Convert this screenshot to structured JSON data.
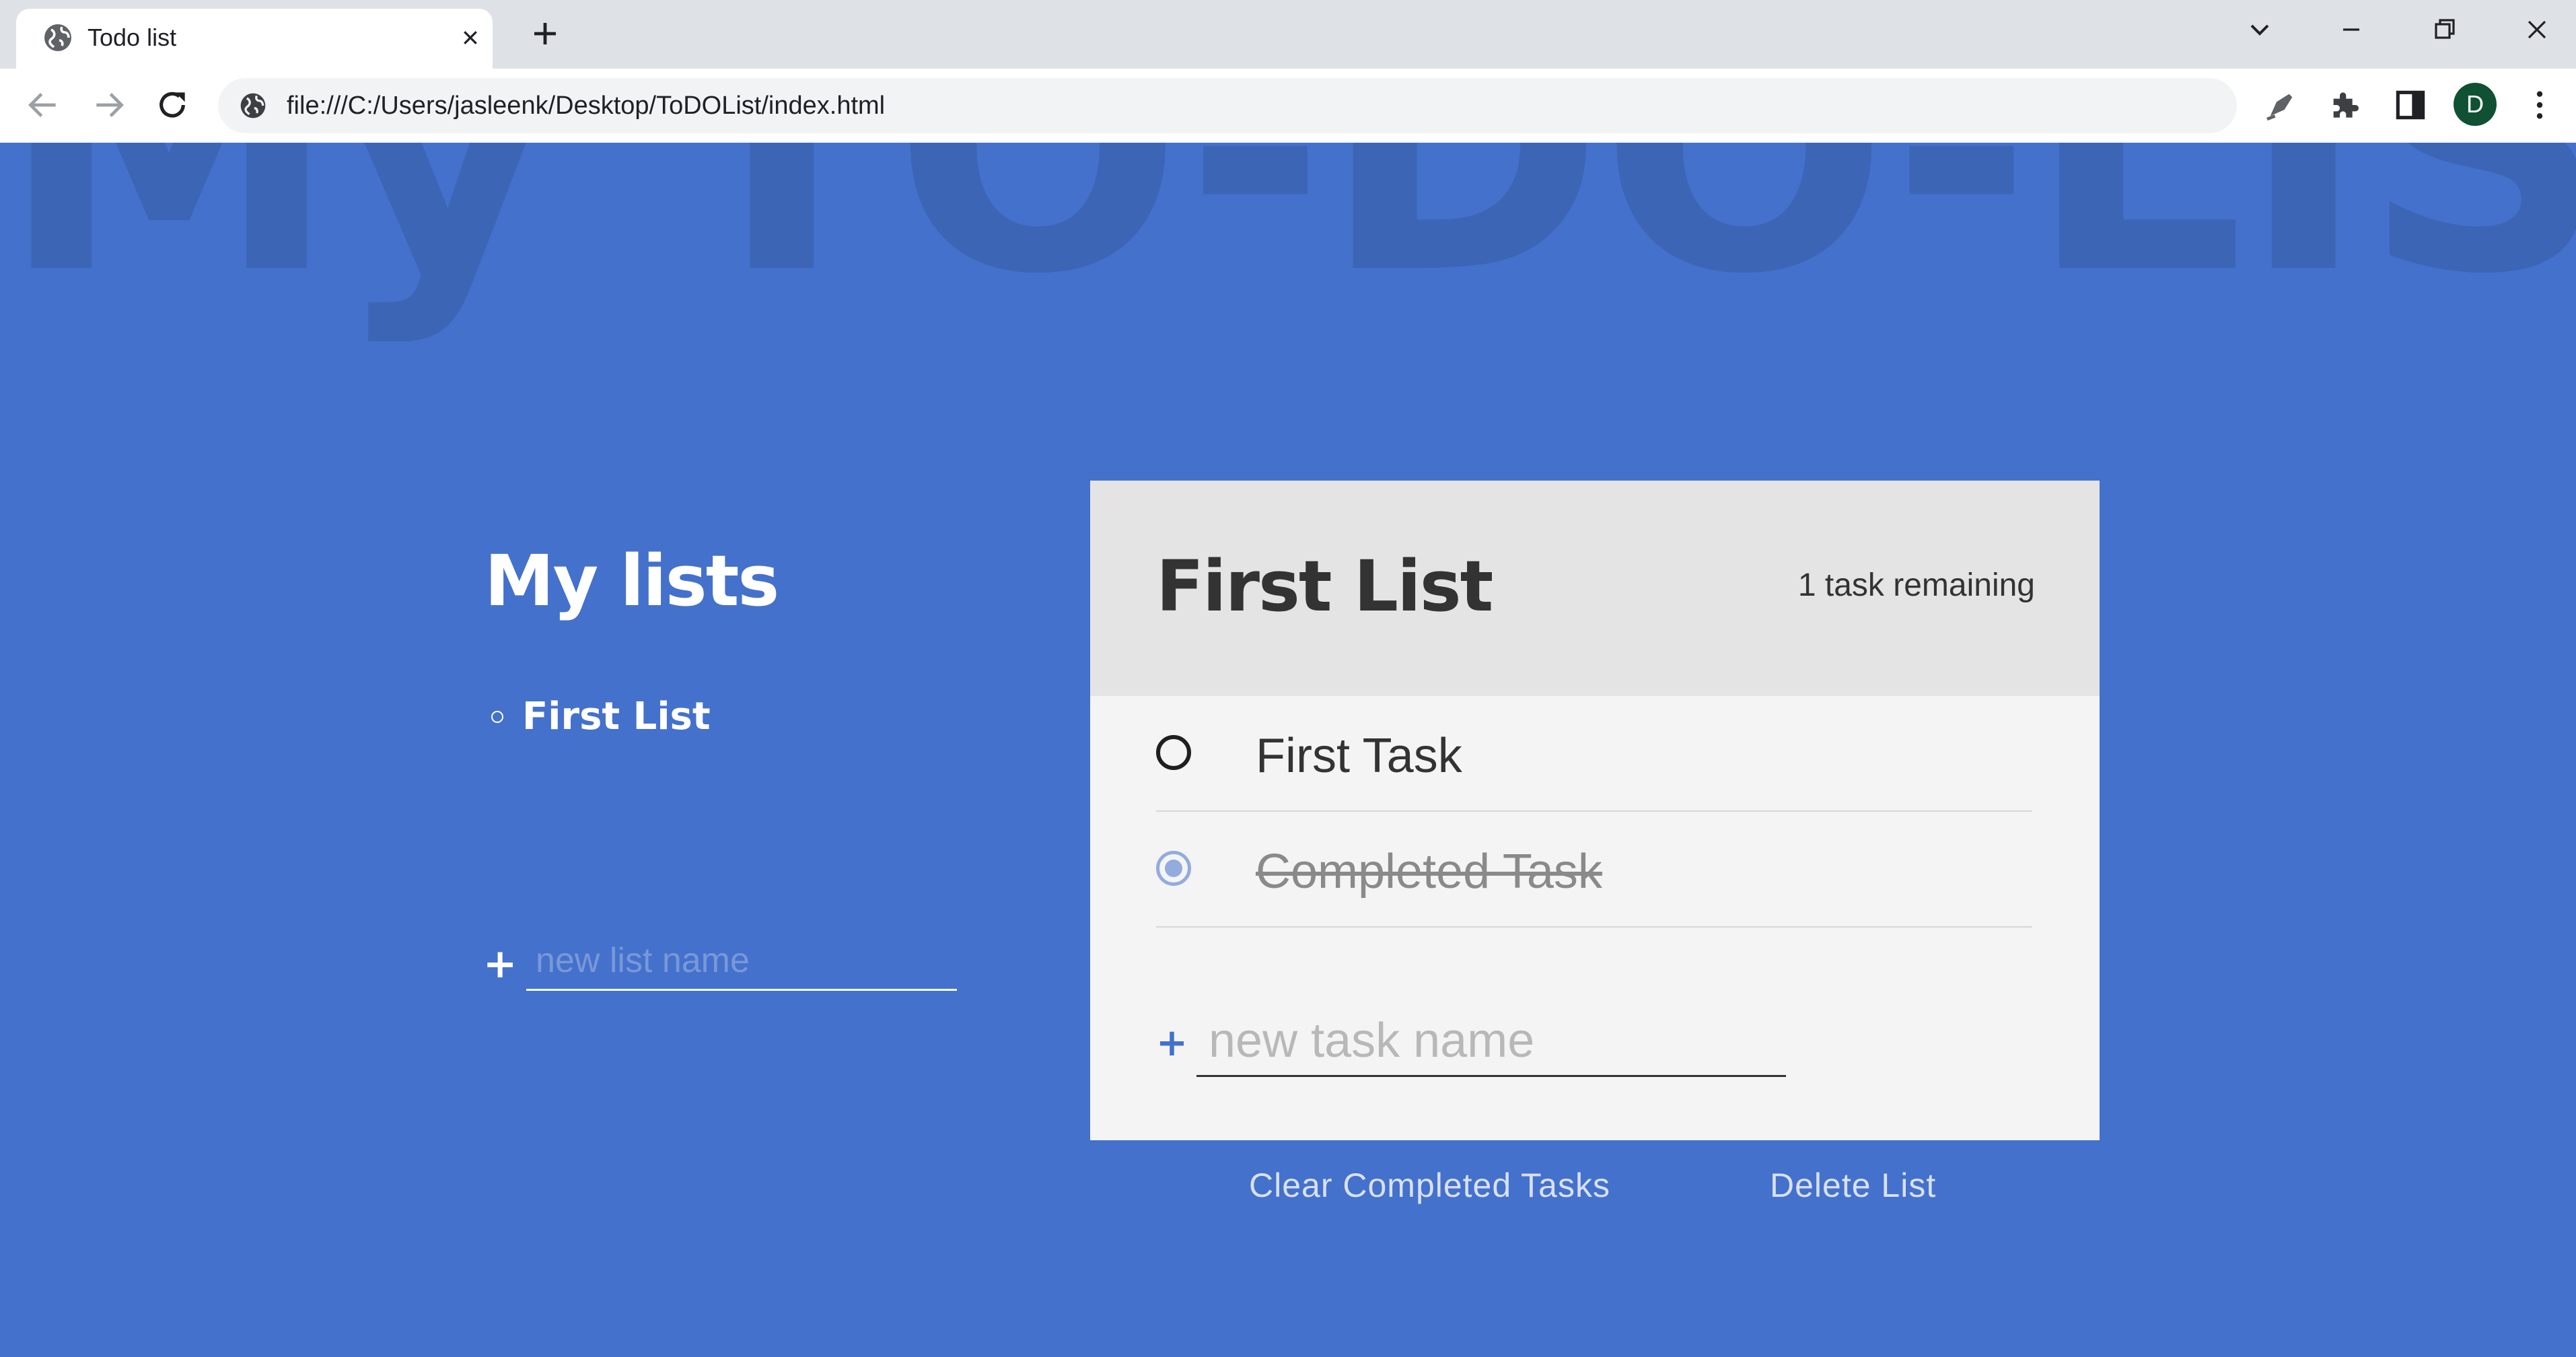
{
  "browser": {
    "tab_title": "Todo list",
    "url": "file:///C:/Users/jasleenk/Desktop/ToDOList/index.html",
    "profile_initial": "D"
  },
  "page": {
    "background_title": "My TO-DO-LIST",
    "lists_heading": "My lists",
    "lists": [
      {
        "label": "First List"
      }
    ],
    "new_list_placeholder": "new list name",
    "card": {
      "title": "First List",
      "task_count": "1 task remaining",
      "tasks": [
        {
          "label": "First Task",
          "completed": false
        },
        {
          "label": "Completed Task",
          "completed": true
        }
      ],
      "new_task_placeholder": "new task name"
    },
    "clear_completed_label": "Clear Completed Tasks",
    "delete_list_label": "Delete List"
  },
  "colors": {
    "page_background": "#4471cb",
    "card_background": "#f4f4f4",
    "card_header": "#e4e4e4",
    "accent": "#4471cb"
  }
}
